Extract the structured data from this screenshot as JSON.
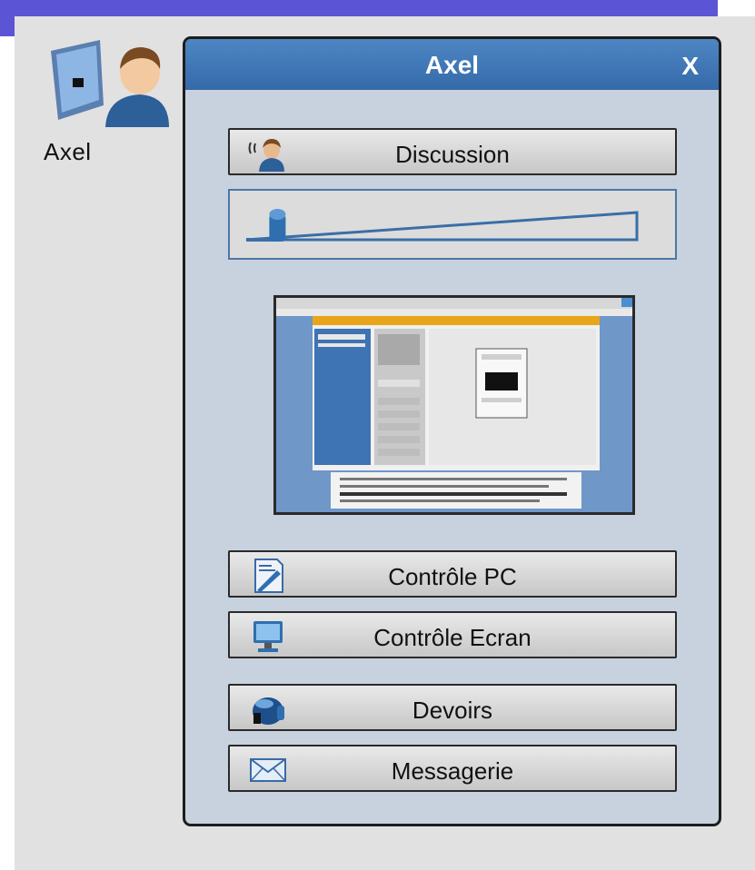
{
  "desktop": {
    "user_label": "Axel"
  },
  "panel": {
    "title": "Axel",
    "close_label": "X",
    "buttons": {
      "discussion": "Discussion",
      "controle_pc": "Contrôle PC",
      "controle_ecran": "Contrôle Ecran",
      "devoirs": "Devoirs",
      "messagerie": "Messagerie"
    },
    "volume_level": 0.08
  },
  "colors": {
    "accent_bar": "#5b55d6",
    "panel_header": "#3f76b7",
    "panel_body": "#c7d2de",
    "background": "#e1e1e1"
  },
  "icons": {
    "user": "user-computer-icon",
    "discussion": "headset-user-icon",
    "controle_pc": "document-pen-icon",
    "controle_ecran": "monitor-icon",
    "devoirs": "helmet-icon",
    "messagerie": "envelope-icon"
  }
}
